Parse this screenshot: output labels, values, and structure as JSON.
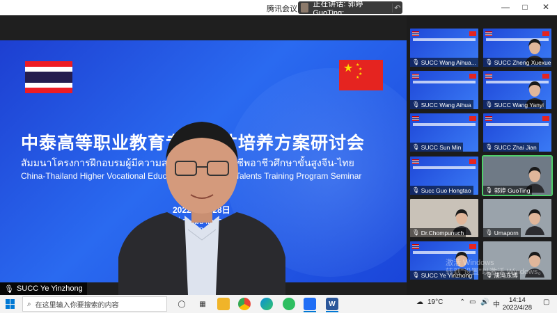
{
  "window": {
    "app_title": "腾讯会议",
    "speaker_label": "正在讲话: 郭婷 GuoTing;",
    "controls": [
      "—",
      "□",
      "✕"
    ]
  },
  "slide": {
    "cn_title": "中泰高等职业教育专业人才培养方案研讨会",
    "th_title": "สัมมนาโครงการฝึกอบรมผู้มีความสามารถสาขาวิชาชีพอาชีวศึกษาขั้นสูงจีน-ไทย",
    "en_title": "China-Thailand Higher Vocational Education Professional Talents Training Program Seminar",
    "date_cn": "2022年4月28日",
    "date_th": "วันที่ 28 เมษายน 2565",
    "date_en": "April 28, 2022"
  },
  "presenter": {
    "name": "SUCC Ye Yinzhong",
    "mic_icon": "microphone-icon"
  },
  "participants": [
    {
      "name": "SUCC Wang Aihua...",
      "kind": "slide"
    },
    {
      "name": "SUCC Zheng Xuexue",
      "kind": "slide-face"
    },
    {
      "name": "SUCC Wang Aihua",
      "kind": "slide"
    },
    {
      "name": "SUCC Wang Yanyi",
      "kind": "slide-face"
    },
    {
      "name": "SUCC Sun Min",
      "kind": "slide"
    },
    {
      "name": "SUCC Zhai Jian",
      "kind": "slide"
    },
    {
      "name": "Succ Guo Hongtao",
      "kind": "slide"
    },
    {
      "name": "郭婷 GuoTing",
      "kind": "photo",
      "active": true
    },
    {
      "name": "Dr.Chompunuch",
      "kind": "room"
    },
    {
      "name": "Umaporn",
      "kind": "office"
    },
    {
      "name": "SUCC Ye Yinzhong",
      "kind": "slide-face"
    },
    {
      "name": "唐冯东博",
      "kind": "office"
    }
  ],
  "watermark": {
    "line1": "激活 Windows",
    "line2": "转到\"设置\"以激活 Windows。"
  },
  "taskbar": {
    "search_placeholder": "在这里输入你要搜索的内容",
    "weather": "19°C",
    "ime": "中",
    "time": "14:14",
    "date": "2022/4/28"
  },
  "colors": {
    "slide_blue": "#1d3fd1",
    "active_border": "#4fd06a",
    "windows_blue": "#0078d4"
  }
}
